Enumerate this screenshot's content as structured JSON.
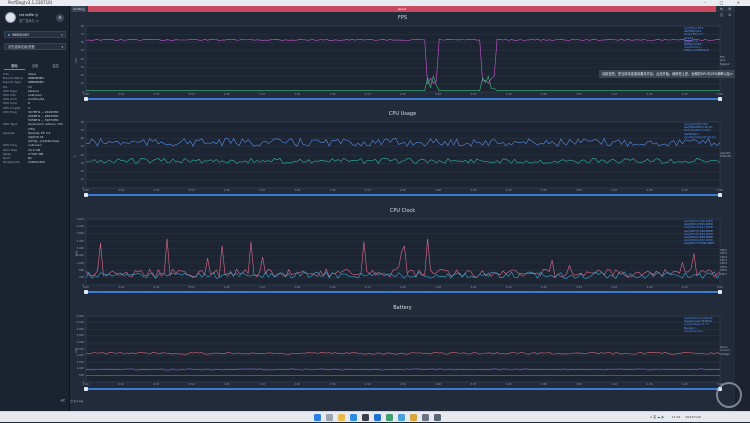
{
  "window": {
    "title": "PerfDog(v3.1.230716)",
    "controls": [
      "–",
      "□",
      "×"
    ]
  },
  "user": {
    "name": "rat taiRe ◎",
    "status": "无广告永久 ◎",
    "icon": "settings-icon"
  },
  "device_select": {
    "value": "9BB0B0B3",
    "arrow": "▽"
  },
  "app_select": {
    "value": "请先选择应用/进程",
    "arrow": "▾"
  },
  "side_tabs": [
    "基础",
    "设置",
    "监控"
  ],
  "device_info": [
    {
      "k": "Info",
      "v": "Value"
    },
    {
      "k": "Device Name",
      "v": "9BB0B0B3"
    },
    {
      "k": "Device Type",
      "v": "9BB0B0B3"
    },
    {
      "k": "OS",
      "v": "13"
    },
    {
      "k": "CPU Type",
      "v": "kalama"
    },
    {
      "k": "CPU Info",
      "v": "unknown"
    },
    {
      "k": "CPU Arch",
      "v": "arm64-v8a"
    },
    {
      "k": "CPU Core",
      "v": "8"
    },
    {
      "k": "CPU Cluster",
      "v": "3"
    },
    {
      "k": "CPU Freq",
      "v": "307MHz ~ 2016MHz\n499MHz ~ 2803MHz\n595MHz ~ 3187MHz"
    },
    {
      "k": "GPU Type",
      "v": "Qualcomm Adreno 740 (TM)"
    },
    {
      "k": "OpenGL",
      "v": "OpenGL ES 3.2\nV@676.32\n(GIT@...)(4ef4bc4ae)"
    },
    {
      "k": "GPU Freq",
      "v": "unknown"
    },
    {
      "k": "Ram Size",
      "v": "15.6 GB"
    },
    {
      "k": "Swap",
      "v": "17287 MB"
    },
    {
      "k": "Root",
      "v": "No"
    },
    {
      "k": "DisplayInfo",
      "v": "1080x2400"
    }
  ],
  "top": {
    "tab": "PerfDog",
    "banner": "label1",
    "icons": [
      "⊕",
      "⚙",
      "◫",
      "⊡"
    ]
  },
  "tooltip": "请检查您，您当前未连接设备并开启，点击开始，使用您上述，全局的GPU与CPU频率以及>",
  "x_ticks": [
    "0:00",
    "0:16",
    "0:33",
    "0:50",
    "1:06",
    "1:23",
    "1:40",
    "1:56",
    "2:13",
    "2:30",
    "2:46",
    "3:03",
    "3:20",
    "3:36",
    "3:53",
    "4:10",
    "4:26",
    "4:43",
    "5:00"
  ],
  "panels": [
    {
      "title": "FPS",
      "yaxis": "FPS",
      "yticks": [
        "80",
        "70",
        "60",
        "50",
        "40",
        "30",
        "20",
        "10",
        "0"
      ],
      "legend": [
        "Avg(FPS)=58.6",
        "Var(FPS)=0.0",
        "Drop(FPS)=0.7",
        "Jank=2",
        "BigJank=0",
        "Stutter=0.6%",
        "InterFrame=--",
        "FTime>=100ms=0"
      ],
      "right": [
        "FPS",
        "Jank",
        "BigJank"
      ]
    },
    {
      "title": "CPU Usage",
      "yaxis": "%",
      "yticks": [
        "80",
        "70",
        "60",
        "50",
        "40",
        "30",
        "20",
        "10",
        "0"
      ],
      "legend": [
        "Avg(AppCPU)=N/A",
        "Avg(TotalCPU)=32.1%",
        "Max(TotalCPU)=44%",
        "CpuTemp=--",
        "Avg(Normalized)=18.2%"
      ],
      "right": [
        "AppCPU",
        "TotalCPU"
      ]
    },
    {
      "title": "CPU Clock",
      "yaxis": "MHz",
      "yticks": [
        "3,600",
        "3,200",
        "2,800",
        "2,400",
        "2,000",
        "1,600",
        "1,200",
        "800",
        "400",
        "0"
      ],
      "legend": [
        "Avg(CPU0)=596.2MHz",
        "Avg(CPU1)=581.4MHz",
        "Avg(CPU2)=611.3MHz",
        "Avg(CPU3)=592.6MHz",
        "Avg(CPU4)=844.4MHz",
        "Avg(CPU5)=848.9MHz",
        "Avg(CPU6)=852.2MHz",
        "Avg(CPU7)=1094.4MHz"
      ],
      "right": [
        "CPU0",
        "CPU1",
        "CPU2",
        "CPU3",
        "CPU4",
        "CPU5",
        "CPU6",
        "CPU7"
      ]
    },
    {
      "title": "Battery",
      "yaxis": "mW",
      "yticks": [
        "5,000",
        "4,500",
        "4,000",
        "3,500",
        "3,000",
        "2,500",
        "2,000",
        "1,500",
        "1,000",
        "500",
        "0"
      ],
      "legend": [
        "Avg(Power)=2184mW",
        "Avg(Current)=448mA",
        "Avg(Voltage)=4.7V",
        "Energy=--",
        "Temperature=--"
      ],
      "right": [
        "Power",
        "Current",
        "Voltage"
      ]
    }
  ],
  "footer": "◫ ◎ Log",
  "taskbar": {
    "time": "12:01",
    "date": "2023/7/16",
    "tray": "∧ 英 ☁ 🔊"
  },
  "colors": {
    "accent": "#3a8dff",
    "banner": "#c94a5e",
    "fps": "#c95ad6",
    "jank": "#3fbf7f",
    "cpu_total": "#5a8ee8",
    "cpu_app": "#2fb6a8",
    "cpu_clock_a": "#e06b8c",
    "cpu_clock_b": "#3aa7d8",
    "battery": "#d46a7a"
  }
}
